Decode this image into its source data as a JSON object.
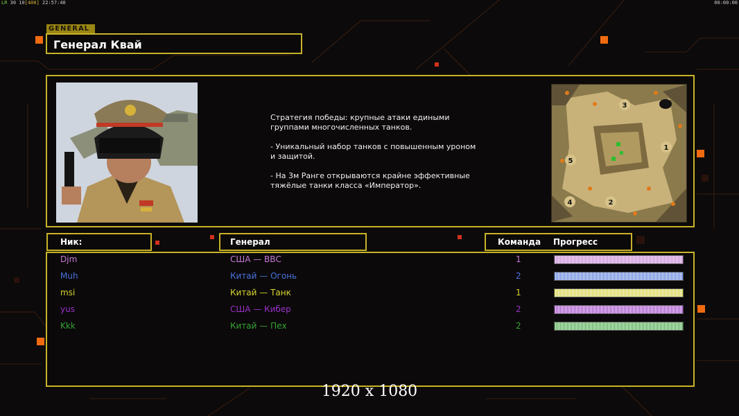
{
  "status": {
    "left_prefix": "LR",
    "left_counts": "30 10",
    "left_limit": "[400]",
    "left_time": "22:57:40",
    "right_time": "00:00:00"
  },
  "general": {
    "tag": "GENERAL",
    "name": "Генерал Квай",
    "description": [
      "Стратегия победы: крупные атаки едиными\n группами многочисленных танков.",
      "- Уникальный набор танков с повышенным уроном\n и защитой.",
      "- На 3м Ранге открываются крайне эффективные\n тяжёлые танки класса «Император»."
    ]
  },
  "minimap": {
    "start_positions": [
      "3",
      "1",
      "5",
      "4",
      "2"
    ]
  },
  "table": {
    "headers": {
      "nick": "Ник:",
      "general": "Генерал",
      "team": "Команда",
      "progress": "Прогресс"
    },
    "rows": [
      {
        "nick": "Djm",
        "general": "США — ВВС",
        "team": "1",
        "color": "#c77ad9",
        "progress": 1.0
      },
      {
        "nick": "Muh",
        "general": "Китай — Огонь",
        "team": "2",
        "color": "#4a73e0",
        "progress": 1.0
      },
      {
        "nick": "msi",
        "general": "Китай — Танк",
        "team": "1",
        "color": "#d9d52e",
        "progress": 1.0
      },
      {
        "nick": "yus",
        "general": "США — Кибер",
        "team": "2",
        "color": "#9a31c9",
        "progress": 1.0
      },
      {
        "nick": "Kkk",
        "general": "Китай — Пех",
        "team": "2",
        "color": "#35a336",
        "progress": 1.0
      }
    ]
  },
  "resolution": "1920 x 1080",
  "colors": {
    "frame": "#c9b328",
    "accent_orange": "#f06a10",
    "accent_red": "#d2311c"
  }
}
